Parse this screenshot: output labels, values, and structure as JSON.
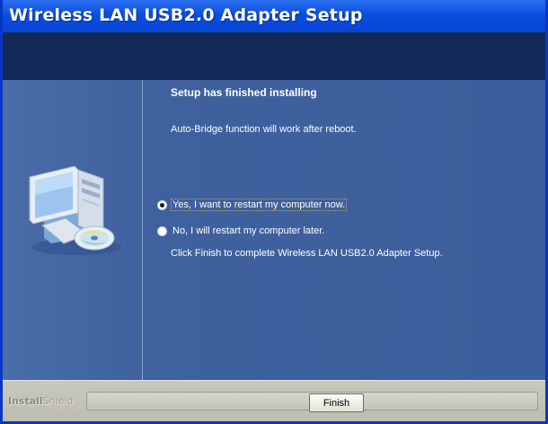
{
  "window": {
    "title": "Wireless LAN USB2.0 Adapter Setup"
  },
  "main": {
    "heading": "Setup has finished installing",
    "subtext": "Auto-Bridge function will work after reboot.",
    "options": [
      {
        "label": "Yes, I want to restart my computer now.",
        "selected": true
      },
      {
        "label": "No, I will restart my computer later.",
        "selected": false
      }
    ],
    "finish_note": "Click Finish to complete Wireless LAN USB2.0 Adapter Setup."
  },
  "footer": {
    "brand_a": "Install",
    "brand_b": "Shield",
    "finish_label": "Finish"
  },
  "colors": {
    "title_bar": "#0a4fe0",
    "header_band": "#132a58",
    "content_bg": "#3c5e9c",
    "footer_bg": "#c4c3b8"
  },
  "icons": {
    "illustration": "computer-with-cd-icon"
  }
}
